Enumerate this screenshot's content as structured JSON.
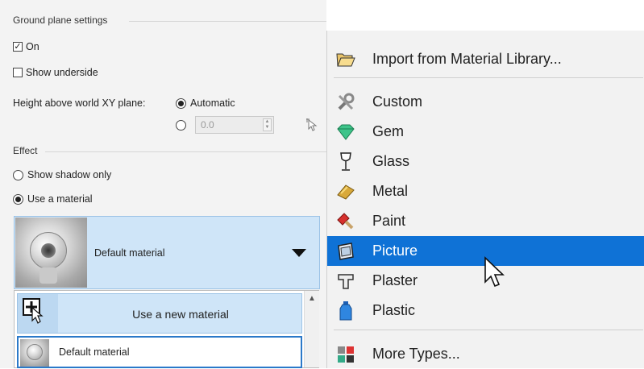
{
  "ground_plane": {
    "group_label": "Ground plane settings",
    "on_label": "On",
    "on_checked": true,
    "show_underside_label": "Show underside",
    "show_underside_checked": false,
    "height_label": "Height above world XY plane:",
    "automatic_label": "Automatic",
    "height_value": "0.0"
  },
  "effect": {
    "group_label": "Effect",
    "shadow_only_label": "Show shadow only",
    "use_material_label": "Use a material",
    "selected_material": "Default material"
  },
  "material_dropdown": {
    "new_material_label": "Use a new material",
    "items": [
      "Default material"
    ]
  },
  "context_menu": {
    "import_label": "Import from Material Library...",
    "items": [
      {
        "label": "Custom",
        "icon": "tools-icon"
      },
      {
        "label": "Gem",
        "icon": "gem-icon"
      },
      {
        "label": "Glass",
        "icon": "wine-glass-icon"
      },
      {
        "label": "Metal",
        "icon": "metal-icon"
      },
      {
        "label": "Paint",
        "icon": "paint-brush-icon"
      },
      {
        "label": "Picture",
        "icon": "picture-icon",
        "selected": true
      },
      {
        "label": "Plaster",
        "icon": "plaster-icon"
      },
      {
        "label": "Plastic",
        "icon": "plastic-bottle-icon"
      }
    ],
    "more_label": "More Types...",
    "selected_color": "#0f72d6"
  }
}
